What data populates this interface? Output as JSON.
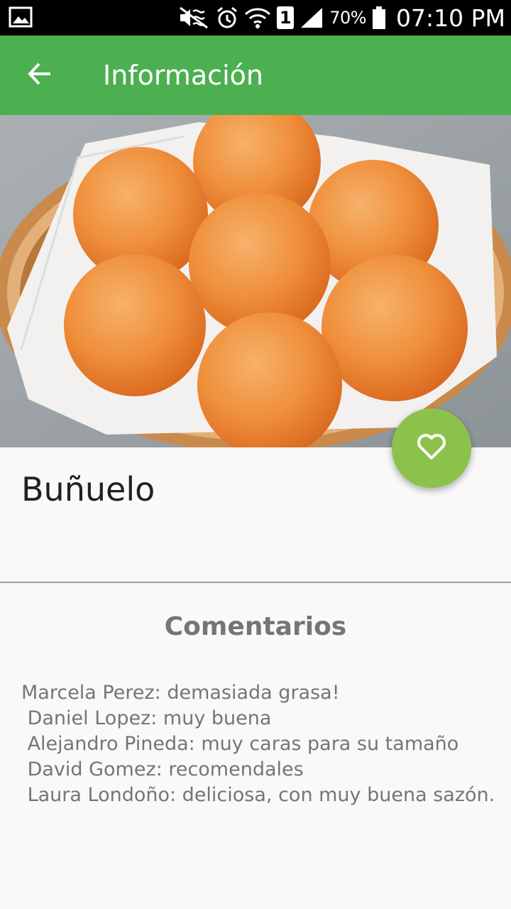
{
  "status_bar": {
    "battery_percent": "70%",
    "time": "07:10 PM",
    "sim_slot": "1",
    "icons": [
      "image-icon",
      "mute-icon",
      "alarm-icon",
      "wifi-icon",
      "sim-icon",
      "signal-icon",
      "battery-icon"
    ]
  },
  "app_bar": {
    "title": "Información",
    "back_icon": "arrow-left-icon"
  },
  "hero": {
    "image_subject": "basket of buñuelos"
  },
  "fab": {
    "icon": "heart-outline-icon"
  },
  "item": {
    "title": "Buñuelo"
  },
  "comments": {
    "heading": "Comentarios",
    "items": [
      "Marcela Perez: demasiada grasa!",
      " Daniel Lopez: muy buena",
      " Alejandro Pineda: muy caras para su tamaño",
      " David Gomez: recomendales",
      " Laura Londoño: deliciosa, con muy buena sazón."
    ]
  },
  "colors": {
    "app_bar": "#4caf50",
    "fab": "#8bc34a",
    "background": "#f9f9f9",
    "title_text": "#212121",
    "secondary_text": "#757575"
  }
}
